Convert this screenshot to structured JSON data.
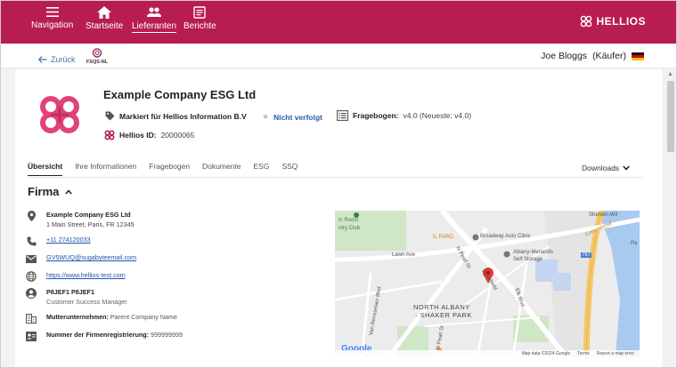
{
  "topbar": {
    "items": [
      {
        "label": "Navigation",
        "icon": "menu-icon"
      },
      {
        "label": "Startseite",
        "icon": "home-icon"
      },
      {
        "label": "Lieferanten",
        "icon": "people-icon",
        "active": true
      },
      {
        "label": "Berichte",
        "icon": "report-icon"
      }
    ],
    "brand": "HELLIOS",
    "color": "#b71c52"
  },
  "subbar": {
    "back_label": "Zurück",
    "badge_label": "FSQS-NL",
    "user_label": "Joe Bloggs",
    "role_label": "(Käufer)"
  },
  "company": {
    "name": "Example Company ESG Ltd",
    "marked_label": "Markiert für Hellios Information B.V",
    "follow_label": "Nicht verfolgt",
    "questionnaire_label": "Fragebogen:",
    "questionnaire_value": "v4.0 (Neueste: v4.0)",
    "id_label": "Hellios ID:",
    "id_value": "20000065"
  },
  "tabs": [
    "Übersicht",
    "Ihre Informationen",
    "Fragebogen",
    "Dokumente",
    "ESG",
    "SSQ"
  ],
  "downloads_label": "Downloads",
  "section": {
    "title": "Firma"
  },
  "info": {
    "company_name": "Example Company ESG Ltd",
    "address": "1 Main Street, Paris, FR 12345",
    "phone": "+11 274120033",
    "email": "GV5WUQ@sugabyteemail.com",
    "website": "https://www.hellios-test.com",
    "contact_name": "P8JEF1 P8JEF1",
    "contact_role": "Customer Success Manager",
    "parent_label": "Mutterunternehmen:",
    "parent_value": "Parent Company Name",
    "reg_label": "Nummer der Firmenregistrierung:",
    "reg_value": "999999999"
  },
  "map": {
    "labels": {
      "roost": "ts Roost",
      "club": "ntry Club",
      "sherwin": "Sherwin-Wil",
      "commercial": "Commercial",
      "ilfaro": "IL FARO",
      "broadway": "Broadway Auto Clinic",
      "albany": "Albany-Menands",
      "selfstorage": "Self Storage",
      "northalbany": "NORTH ALBANY",
      "shaker": "· SHAKER PARK",
      "pearl": "N Pearl St",
      "pearl2": "N Pearl St",
      "vanrens": "Van Rensselaer Blvd",
      "elk": "Elk Blvd",
      "lawn": "Lawn Ave",
      "broadway_st": "Broadway",
      "route": "787",
      "pa": "Pa"
    },
    "google": "Google",
    "footer_data": "Map data ©2024 Google",
    "footer_terms": "Terms",
    "footer_report": "Report a map error"
  }
}
